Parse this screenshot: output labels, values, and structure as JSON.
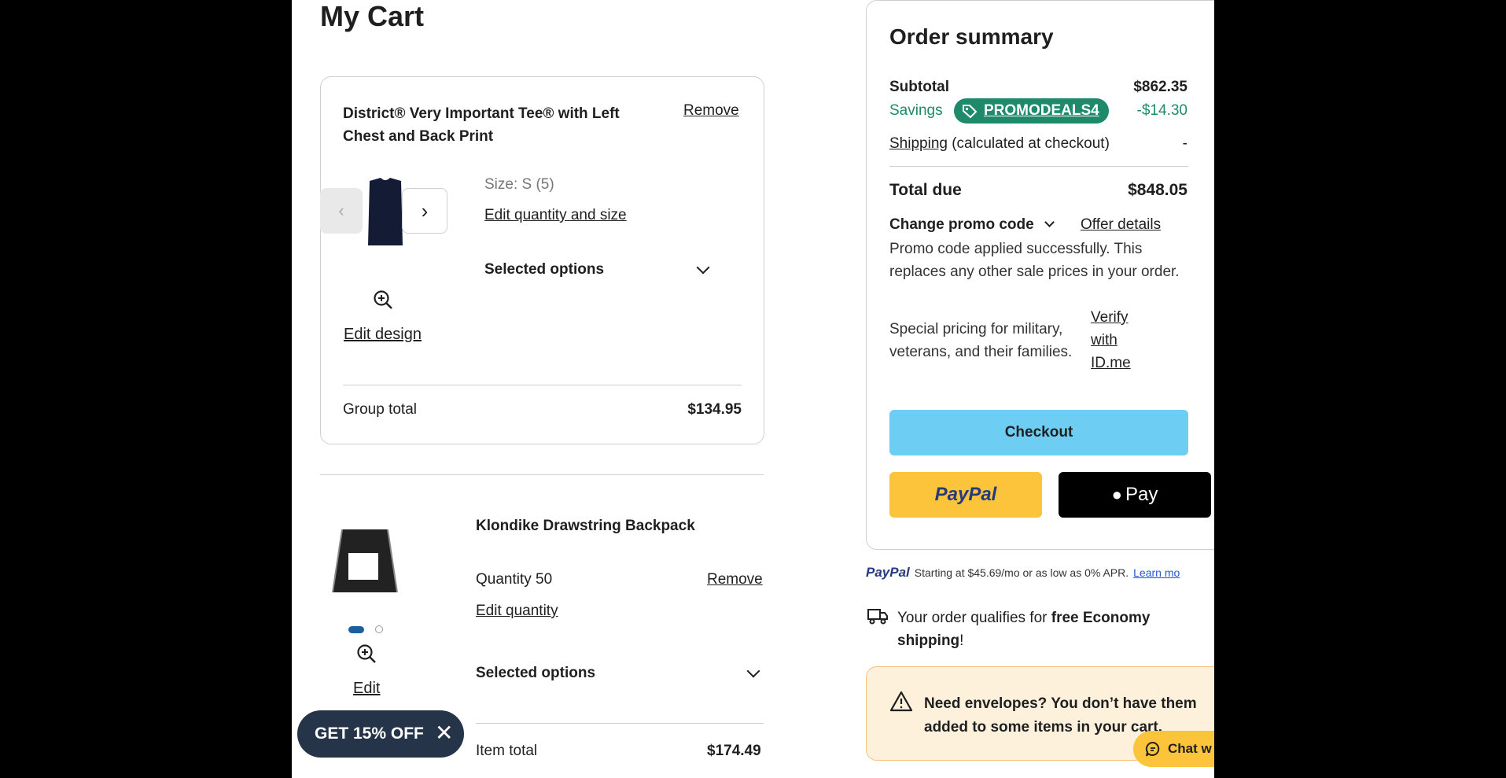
{
  "cart": {
    "title": "My Cart",
    "item1": {
      "name_line1": "District® Very Important Tee® with Left",
      "name_line2": "Chest and Back Print",
      "remove": "Remove",
      "size": "Size: S (5)",
      "edit_qty_size": "Edit quantity and size",
      "selected_options": "Selected options",
      "edit_design": "Edit design",
      "group_total_label": "Group total",
      "group_total_value": "$134.95"
    },
    "item2": {
      "name": "Klondike Drawstring Backpack",
      "quantity": "Quantity 50",
      "remove": "Remove",
      "edit_qty": "Edit quantity",
      "selected_options": "Selected options",
      "edit": "Edit",
      "item_total_label": "Item total",
      "item_total_value": "$174.49"
    },
    "promo_pill": "GET 15% OFF"
  },
  "summary": {
    "title": "Order summary",
    "subtotal_label": "Subtotal",
    "subtotal_value": "$862.35",
    "savings_label": "Savings",
    "promo_code": "PROMODEALS4",
    "savings_value": "-$14.30",
    "shipping_link": "Shipping",
    "shipping_note": "(calculated at checkout)",
    "shipping_value": "-",
    "total_label": "Total due",
    "total_value": "$848.05",
    "change_promo": "Change promo code",
    "offer_details": "Offer details",
    "promo_msg1": "Promo code applied successfully. This",
    "promo_msg2": "replaces any other sale prices in your order.",
    "special1": "Special pricing for military,",
    "special2": "veterans, and their families.",
    "verify1": "Verify",
    "verify2": "with",
    "verify3": "ID.me",
    "checkout": "Checkout",
    "paypal": "PayPal",
    "applepay": "Pay",
    "paypal_logo": "PayPal",
    "paypal_note": "Starting at $45.69/mo or as low as 0% APR.",
    "learn_more": "Learn mo",
    "ship_msg1": "Your order qualifies for ",
    "ship_msg_bold": "free Economy",
    "ship_msg2_bold": "shipping",
    "ship_msg2_end": "!",
    "env_line1": "Need envelopes? You don’t have them",
    "env_line2": "added to some items in your cart.",
    "chat": "Chat w"
  },
  "colors": {
    "green": "#1e8a6a",
    "checkout_blue": "#6dcdf2",
    "paypal_yellow": "#fcc43a",
    "warning_bg": "#fdf1dc",
    "warning_border": "#f3c37c",
    "dark_navy": "#263449"
  }
}
